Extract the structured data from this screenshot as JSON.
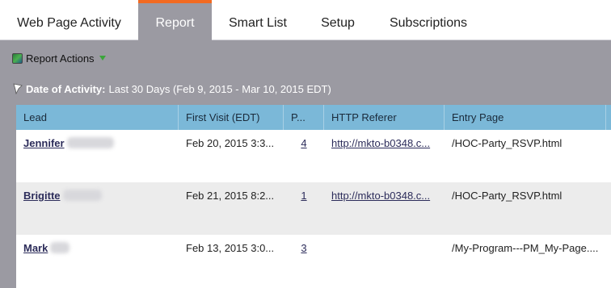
{
  "tabs": [
    {
      "label": "Web Page Activity",
      "active": false
    },
    {
      "label": "Report",
      "active": true
    },
    {
      "label": "Smart List",
      "active": false
    },
    {
      "label": "Setup",
      "active": false
    },
    {
      "label": "Subscriptions",
      "active": false
    }
  ],
  "colors": {
    "accent": "#f26a21",
    "header": "#7bb8d8",
    "toolbar": "#9b9aa2",
    "link": "#2c2c5a"
  },
  "toolbar": {
    "report_actions_label": "Report Actions"
  },
  "filter": {
    "label": "Date of Activity:",
    "value": "Last 30 Days (Feb 9, 2015 - Mar 10, 2015 EDT)"
  },
  "table": {
    "columns": [
      "Lead",
      "First Visit (EDT)",
      "P...",
      "HTTP Referer",
      "Entry Page"
    ],
    "rows": [
      {
        "lead": "Jennifer",
        "first_visit": "Feb 20, 2015 3:3...",
        "pages": "4",
        "referer": "http://mkto-b0348.c...",
        "entry_page": "/HOC-Party_RSVP.html"
      },
      {
        "lead": "Brigitte",
        "first_visit": "Feb 21, 2015 8:2...",
        "pages": "1",
        "referer": "http://mkto-b0348.c...",
        "entry_page": "/HOC-Party_RSVP.html"
      },
      {
        "lead": "Mark",
        "first_visit": "Feb 13, 2015 3:0...",
        "pages": "3",
        "referer": "",
        "entry_page": "/My-Program---PM_My-Page...."
      }
    ]
  }
}
